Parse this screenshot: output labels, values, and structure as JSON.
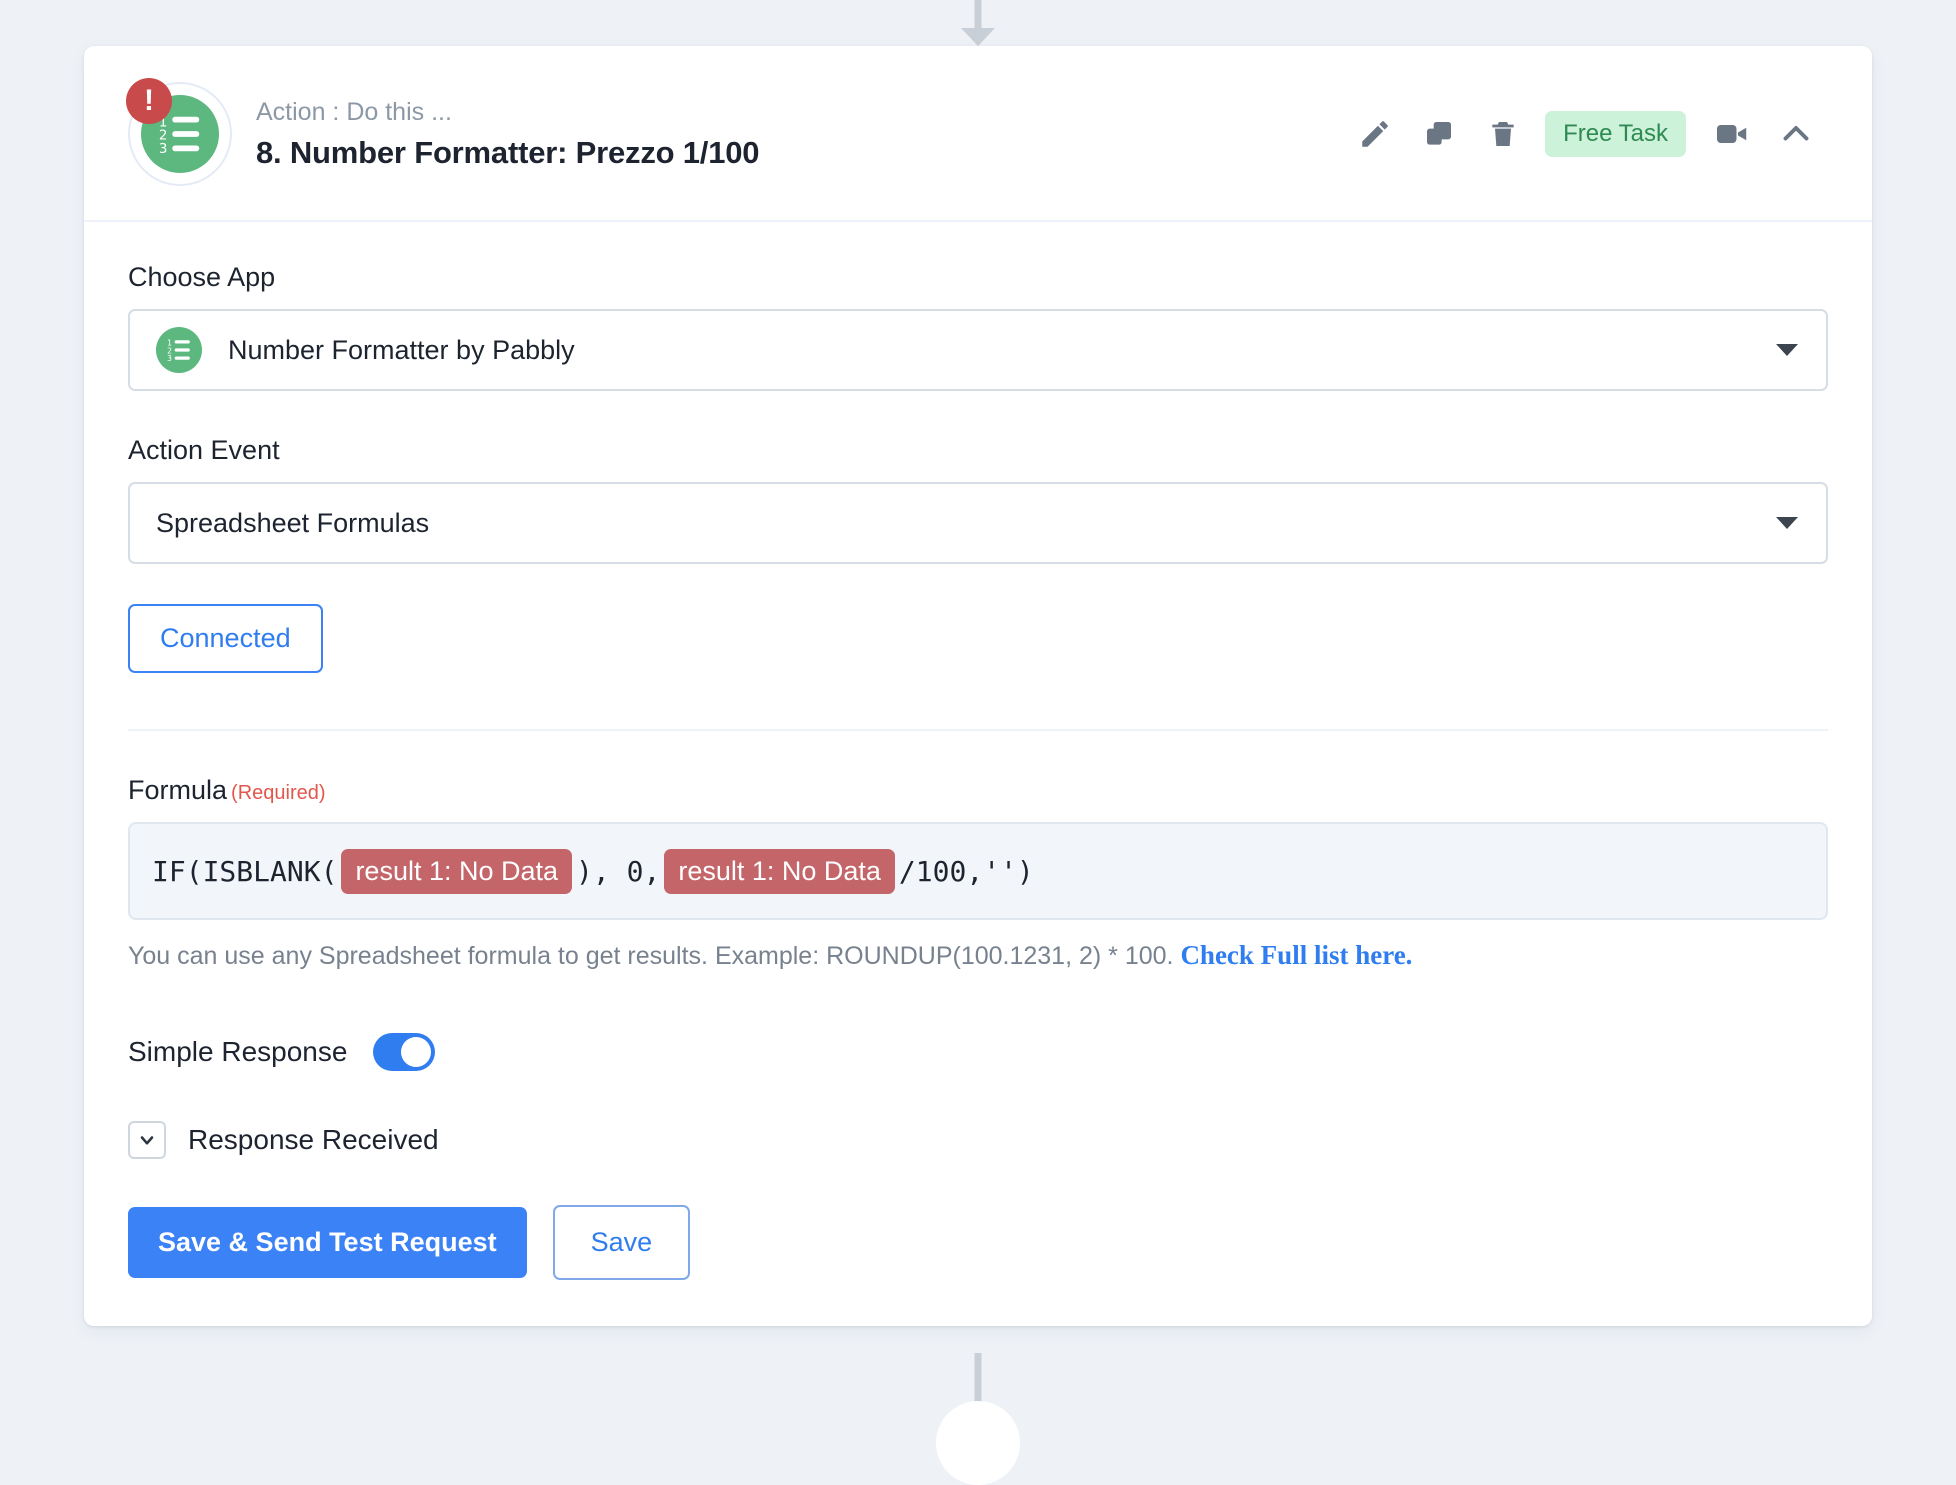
{
  "connectors": {
    "top_arrow": "arrow-down",
    "bottom_node": "circle-node"
  },
  "header": {
    "kicker": "Action : Do this ...",
    "title": "8. Number Formatter: Prezzo 1/100",
    "alert_glyph": "!",
    "step_icon": "number-list-icon",
    "badge_label": "Free Task",
    "tools": [
      {
        "name": "edit-icon",
        "glyph": "pencil"
      },
      {
        "name": "duplicate-icon",
        "glyph": "copy"
      },
      {
        "name": "delete-icon",
        "glyph": "trash"
      },
      {
        "name": "video-icon",
        "glyph": "camera"
      },
      {
        "name": "collapse-icon",
        "glyph": "chevron-up"
      }
    ]
  },
  "choose_app": {
    "label": "Choose App",
    "value": "Number Formatter by Pabbly"
  },
  "action_event": {
    "label": "Action Event",
    "value": "Spreadsheet Formulas"
  },
  "connection": {
    "button_label": "Connected"
  },
  "formula": {
    "label": "Formula",
    "required_note": "(Required)",
    "parts": {
      "p1": "IF(ISBLANK(",
      "token1": "result 1: No Data",
      "p2": "), 0,",
      "token2": "result 1: No Data",
      "p3": "/100,'')"
    },
    "helper_text": "You can use any Spreadsheet formula to get results. Example: ROUNDUP(100.1231, 2) * 100.",
    "helper_link": "Check Full list here."
  },
  "simple_response": {
    "label": "Simple Response",
    "state": "on"
  },
  "response_received": {
    "label": "Response Received",
    "chevron": "chevron-down-icon"
  },
  "actions": {
    "primary_label": "Save & Send Test Request",
    "secondary_label": "Save"
  },
  "colors": {
    "accent_blue": "#3b82f6",
    "green": "#5cb87f",
    "badge_green_bg": "#cdf2da",
    "badge_green_text": "#2f8a52",
    "alert_red": "#c94a4a",
    "token_red": "#c4656a",
    "page_bg": "#eef2f7"
  }
}
